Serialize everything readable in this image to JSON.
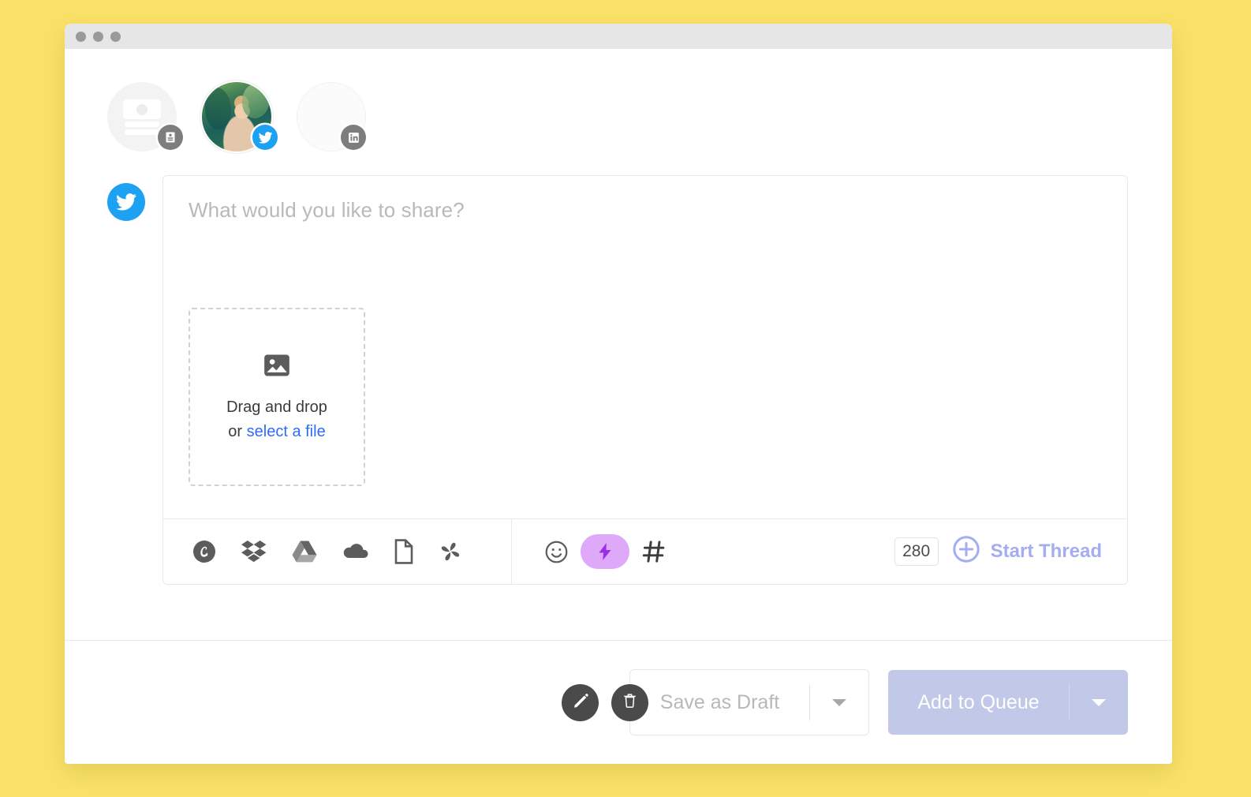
{
  "window": {
    "background_color": "#fae268",
    "titlebar_color": "#e6e6e6",
    "dots": [
      "close",
      "minimize",
      "maximize"
    ]
  },
  "accounts": [
    {
      "id": "placeholder-account",
      "type": "profile",
      "badge_icon": "contact-card-icon",
      "selected": false,
      "has_photo": false
    },
    {
      "id": "twitter-account",
      "type": "twitter",
      "badge_icon": "twitter-icon",
      "selected": true,
      "has_photo": true
    },
    {
      "id": "linkedin-account",
      "type": "linkedin",
      "badge_icon": "linkedin-icon",
      "selected": false,
      "has_photo": false
    }
  ],
  "composer": {
    "channel_icon": "twitter-icon",
    "placeholder": "What would you like to share?",
    "text": "",
    "dropzone": {
      "icon": "image-icon",
      "line1": "Drag and drop",
      "prefix": "or ",
      "link": "select a file"
    }
  },
  "toolbar": {
    "sources": [
      {
        "name": "canva-icon",
        "label": "Canva"
      },
      {
        "name": "dropbox-icon",
        "label": "Dropbox"
      },
      {
        "name": "google-drive-icon",
        "label": "Google Drive"
      },
      {
        "name": "onedrive-icon",
        "label": "OneDrive"
      },
      {
        "name": "box-icon",
        "label": "Box"
      },
      {
        "name": "pinwheel-icon",
        "label": "Google Photos"
      }
    ],
    "tools": [
      {
        "name": "emoji-icon",
        "label": "Emoji"
      },
      {
        "name": "lightning-bolt-icon",
        "label": "AI Assistant"
      },
      {
        "name": "hashtag-icon",
        "label": "Hashtag Manager"
      }
    ],
    "character_count": "280",
    "start_thread_label": "Start Thread",
    "start_thread_color": "#a3adf0",
    "ai_pill_color": "#dda9f8",
    "ai_bolt_color": "#9b2ee8"
  },
  "footer": {
    "edit_button": "pencil-icon",
    "delete_button": "trash-icon",
    "draft_label": "Save as Draft",
    "queue_label": "Add to Queue",
    "queue_color": "#c2c8e7"
  }
}
